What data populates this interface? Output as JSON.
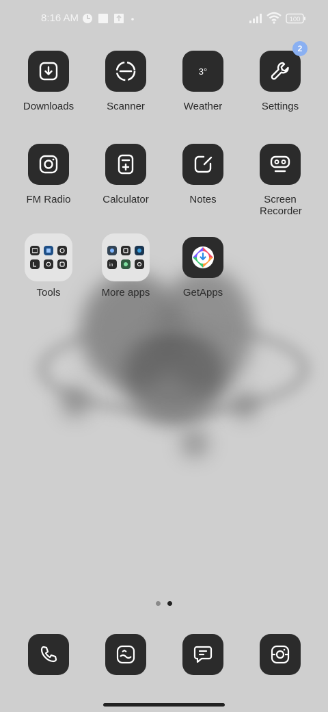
{
  "status_bar": {
    "time": "8:16 AM",
    "battery": "100"
  },
  "apps": [
    {
      "label": "Downloads",
      "icon": "download-icon"
    },
    {
      "label": "Scanner",
      "icon": "scanner-icon"
    },
    {
      "label": "Weather",
      "icon": "weather-icon",
      "tile_text": "3°"
    },
    {
      "label": "Settings",
      "icon": "wrench-icon",
      "badge": "2"
    },
    {
      "label": "FM Radio",
      "icon": "radio-icon"
    },
    {
      "label": "Calculator",
      "icon": "calculator-icon"
    },
    {
      "label": "Notes",
      "icon": "notes-icon"
    },
    {
      "label": "Screen Recorder",
      "icon": "screen-recorder-icon"
    },
    {
      "label": "Tools",
      "icon": "folder-icon"
    },
    {
      "label": "More apps",
      "icon": "folder-icon"
    },
    {
      "label": "GetApps",
      "icon": "getapps-icon"
    }
  ],
  "dock": [
    {
      "name": "phone",
      "icon": "phone-icon"
    },
    {
      "name": "gallery",
      "icon": "gallery-icon"
    },
    {
      "name": "messages",
      "icon": "message-icon"
    },
    {
      "name": "camera",
      "icon": "camera-icon"
    }
  ],
  "pager": {
    "pages": 2,
    "current": 2
  },
  "colors": {
    "tile": "#2b2b2b",
    "badge": "#8ab0f2",
    "background": "#cfcfcf"
  }
}
